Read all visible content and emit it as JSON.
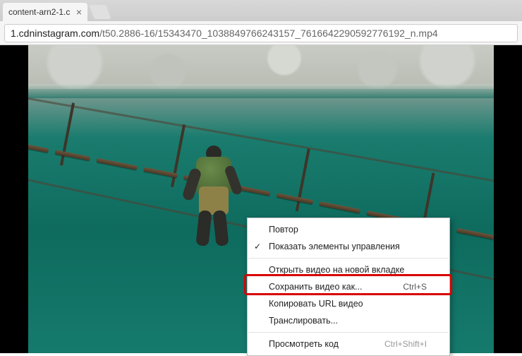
{
  "tab": {
    "title": "content-arn2-1.c",
    "close_glyph": "×"
  },
  "address": {
    "host": "1.cdninstagram.com",
    "path": "/t50.2886-16/15343470_1038849766243157_7616642290592776192_n.mp4"
  },
  "context_menu": {
    "items": [
      {
        "key": "loop",
        "label": "Повтор",
        "checked": false,
        "interactable": true
      },
      {
        "key": "controls",
        "label": "Показать элементы управления",
        "checked": true,
        "interactable": true
      }
    ],
    "items2": [
      {
        "key": "open_new_tab",
        "label": "Открыть видео на новой вкладке",
        "interactable": true
      },
      {
        "key": "save_as",
        "label": "Сохранить видео как...",
        "shortcut": "Ctrl+S",
        "interactable": true,
        "highlighted": true
      },
      {
        "key": "copy_url",
        "label": "Копировать URL видео",
        "interactable": true
      },
      {
        "key": "cast",
        "label": "Транслировать...",
        "interactable": true
      }
    ],
    "items3": [
      {
        "key": "inspect",
        "label": "Просмотреть код",
        "shortcut": "Ctrl+Shift+I",
        "interactable": true
      }
    ]
  }
}
